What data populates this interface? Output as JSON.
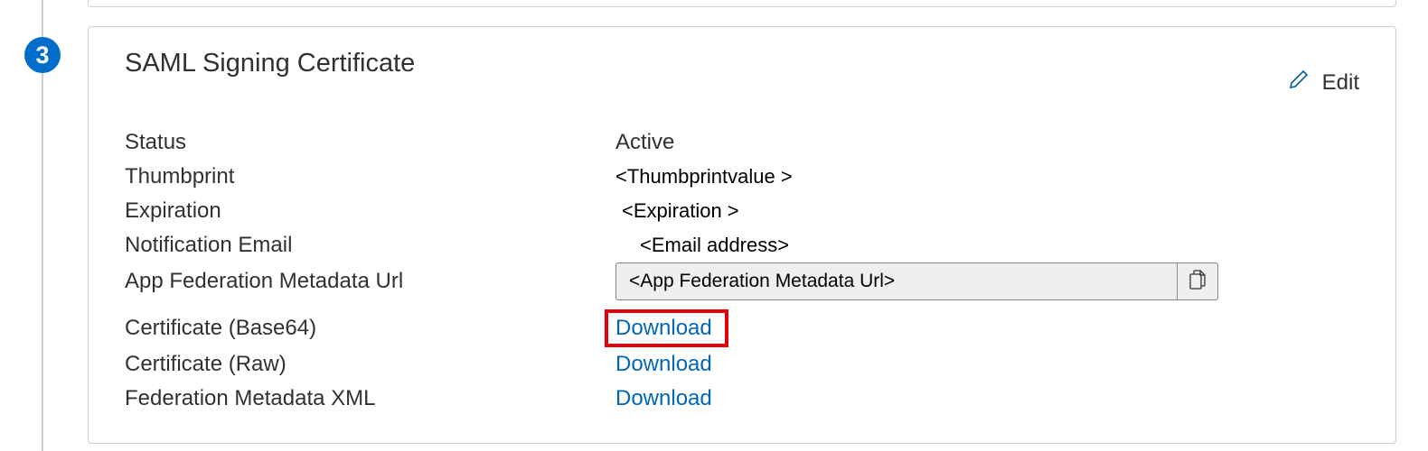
{
  "step_number": "3",
  "card": {
    "title": "SAML Signing Certificate",
    "edit_label": "Edit"
  },
  "fields": {
    "status": {
      "label": "Status",
      "value": "Active"
    },
    "thumbprint": {
      "label": "Thumbprint",
      "value": "<Thumbprintvalue >"
    },
    "expiration": {
      "label": "Expiration",
      "value": "<Expiration >"
    },
    "notification_email": {
      "label": "Notification Email",
      "value": "<Email address>"
    },
    "metadata_url": {
      "label": "App Federation Metadata Url",
      "value": "<App Federation  Metadata Url>"
    },
    "cert_base64": {
      "label": "Certificate (Base64)",
      "action": "Download"
    },
    "cert_raw": {
      "label": "Certificate (Raw)",
      "action": "Download"
    },
    "fed_metadata_xml": {
      "label": "Federation Metadata XML",
      "action": "Download"
    }
  }
}
